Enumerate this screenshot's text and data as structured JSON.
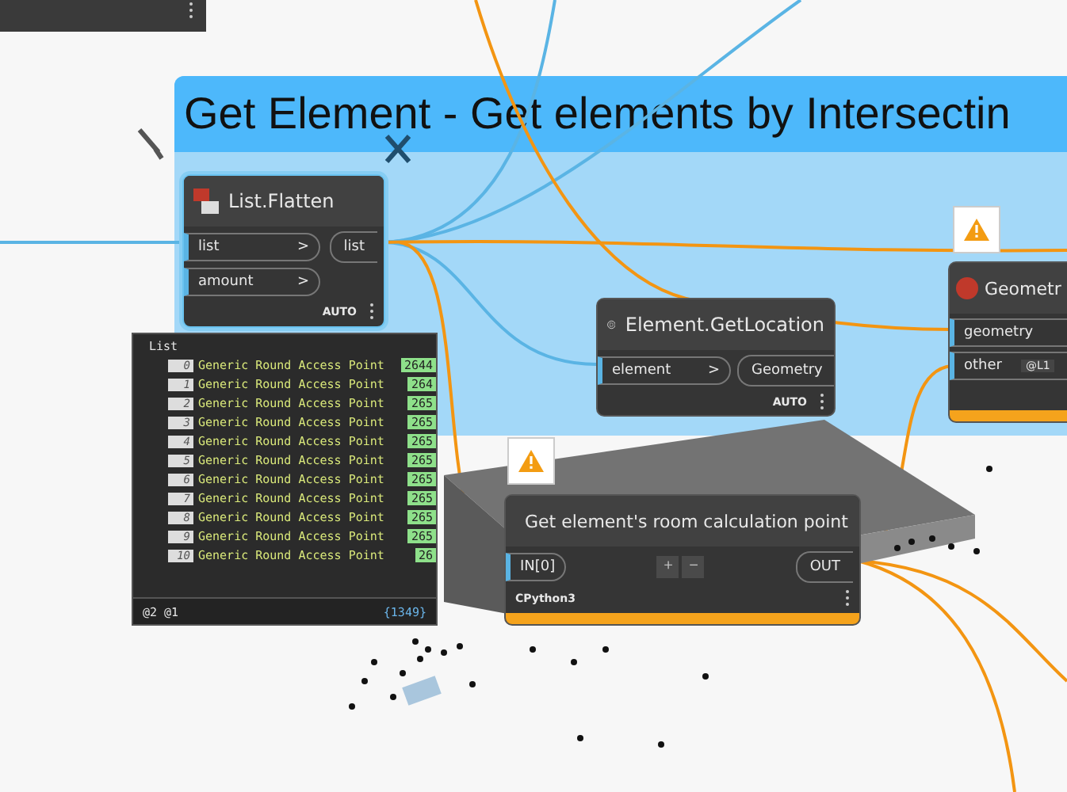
{
  "group": {
    "title": "Get Element - Get elements by Intersectin"
  },
  "flatten": {
    "title": "List.Flatten",
    "inputs": [
      {
        "label": "list",
        "arrow": ">"
      },
      {
        "label": "amount",
        "arrow": ">"
      }
    ],
    "output": "list",
    "lacing": "AUTO"
  },
  "watch": {
    "title": "List",
    "rows": [
      {
        "index": "0",
        "label": "Generic Round Access Point",
        "value": "2644"
      },
      {
        "index": "1",
        "label": "Generic Round Access Point",
        "value": "264"
      },
      {
        "index": "2",
        "label": "Generic Round Access Point",
        "value": "265"
      },
      {
        "index": "3",
        "label": "Generic Round Access Point",
        "value": "265"
      },
      {
        "index": "4",
        "label": "Generic Round Access Point",
        "value": "265"
      },
      {
        "index": "5",
        "label": "Generic Round Access Point",
        "value": "265"
      },
      {
        "index": "6",
        "label": "Generic Round Access Point",
        "value": "265"
      },
      {
        "index": "7",
        "label": "Generic Round Access Point",
        "value": "265"
      },
      {
        "index": "8",
        "label": "Generic Round Access Point",
        "value": "265"
      },
      {
        "index": "9",
        "label": "Generic Round Access Point",
        "value": "265"
      },
      {
        "index": "10",
        "label": "Generic Round Access Point",
        "value": "26"
      }
    ],
    "levels": "@2 @1",
    "count": "{1349}"
  },
  "location": {
    "title": "Element.GetLocation",
    "inputs": [
      {
        "label": "element",
        "arrow": ">"
      }
    ],
    "output": "Geometry",
    "lacing": "AUTO"
  },
  "geometry": {
    "title": "Geometr",
    "inputs": [
      {
        "label": "geometry"
      },
      {
        "label": "other",
        "level": "@L1"
      }
    ],
    "warning": true
  },
  "python": {
    "title": "Get element's room calculation point",
    "input": "IN[0]",
    "add": "+",
    "remove": "−",
    "output": "OUT",
    "engine": "CPython3",
    "warning": true
  }
}
